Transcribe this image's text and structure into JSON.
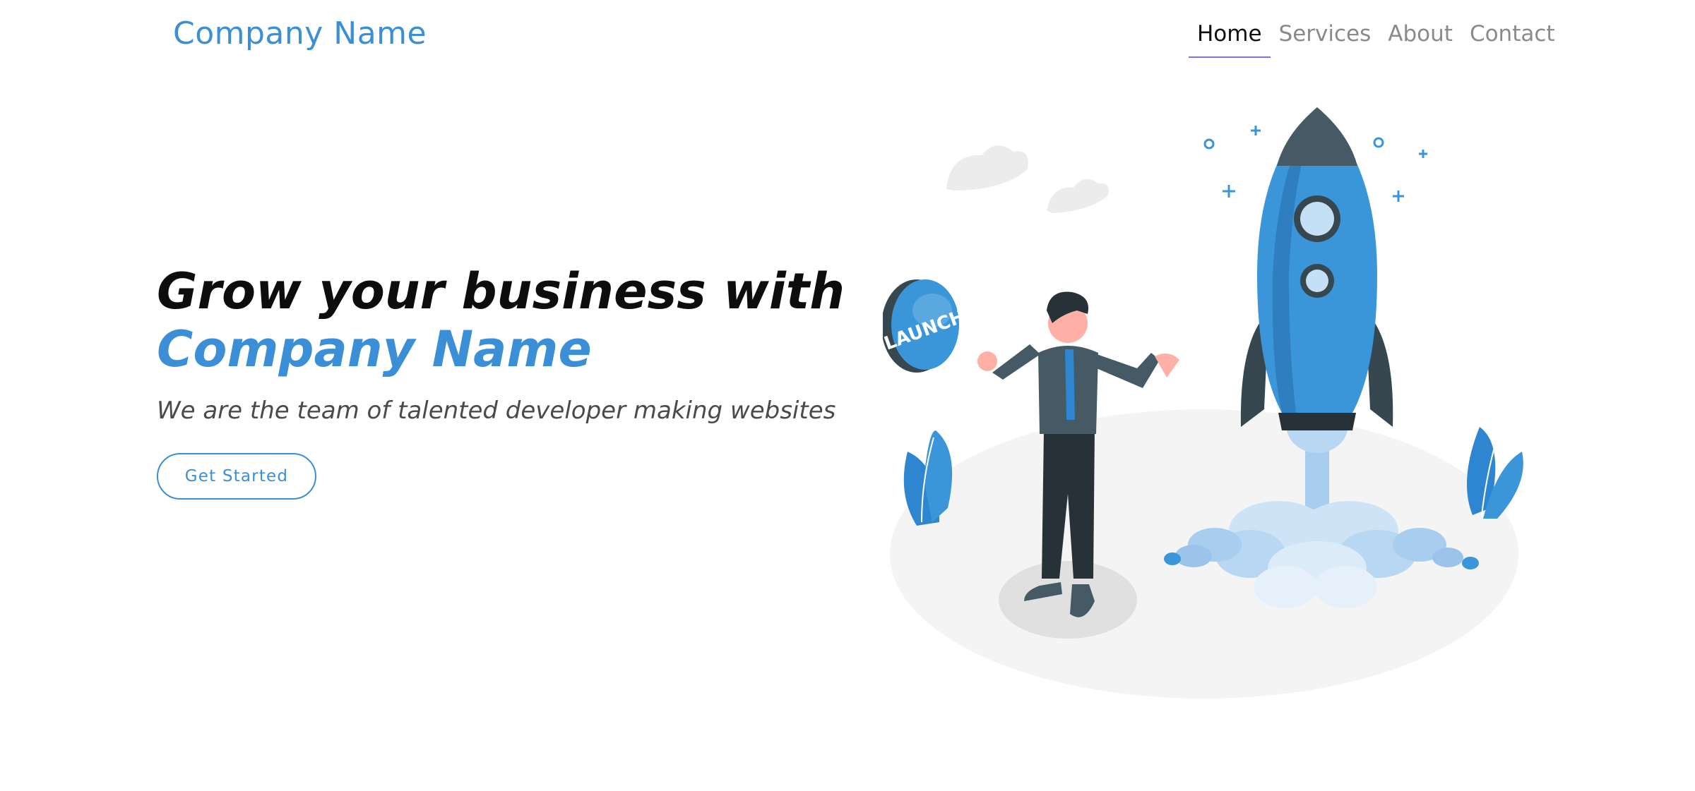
{
  "header": {
    "brand": "Company Name",
    "nav": [
      {
        "label": "Home",
        "active": true
      },
      {
        "label": "Services",
        "active": false
      },
      {
        "label": "About",
        "active": false
      },
      {
        "label": "Contact",
        "active": false
      }
    ]
  },
  "hero": {
    "title_line1": "Grow your business with",
    "title_line2": "Company Name",
    "subtitle": "We are the team of talented developer making websites",
    "cta_label": "Get Started"
  },
  "illustration": {
    "button_text": "LAUNCH"
  },
  "colors": {
    "accent": "#3b8fd6",
    "nav_underline": "#7a74d8",
    "rocket_blue": "#3a96d8",
    "rocket_dark": "#37474f"
  }
}
